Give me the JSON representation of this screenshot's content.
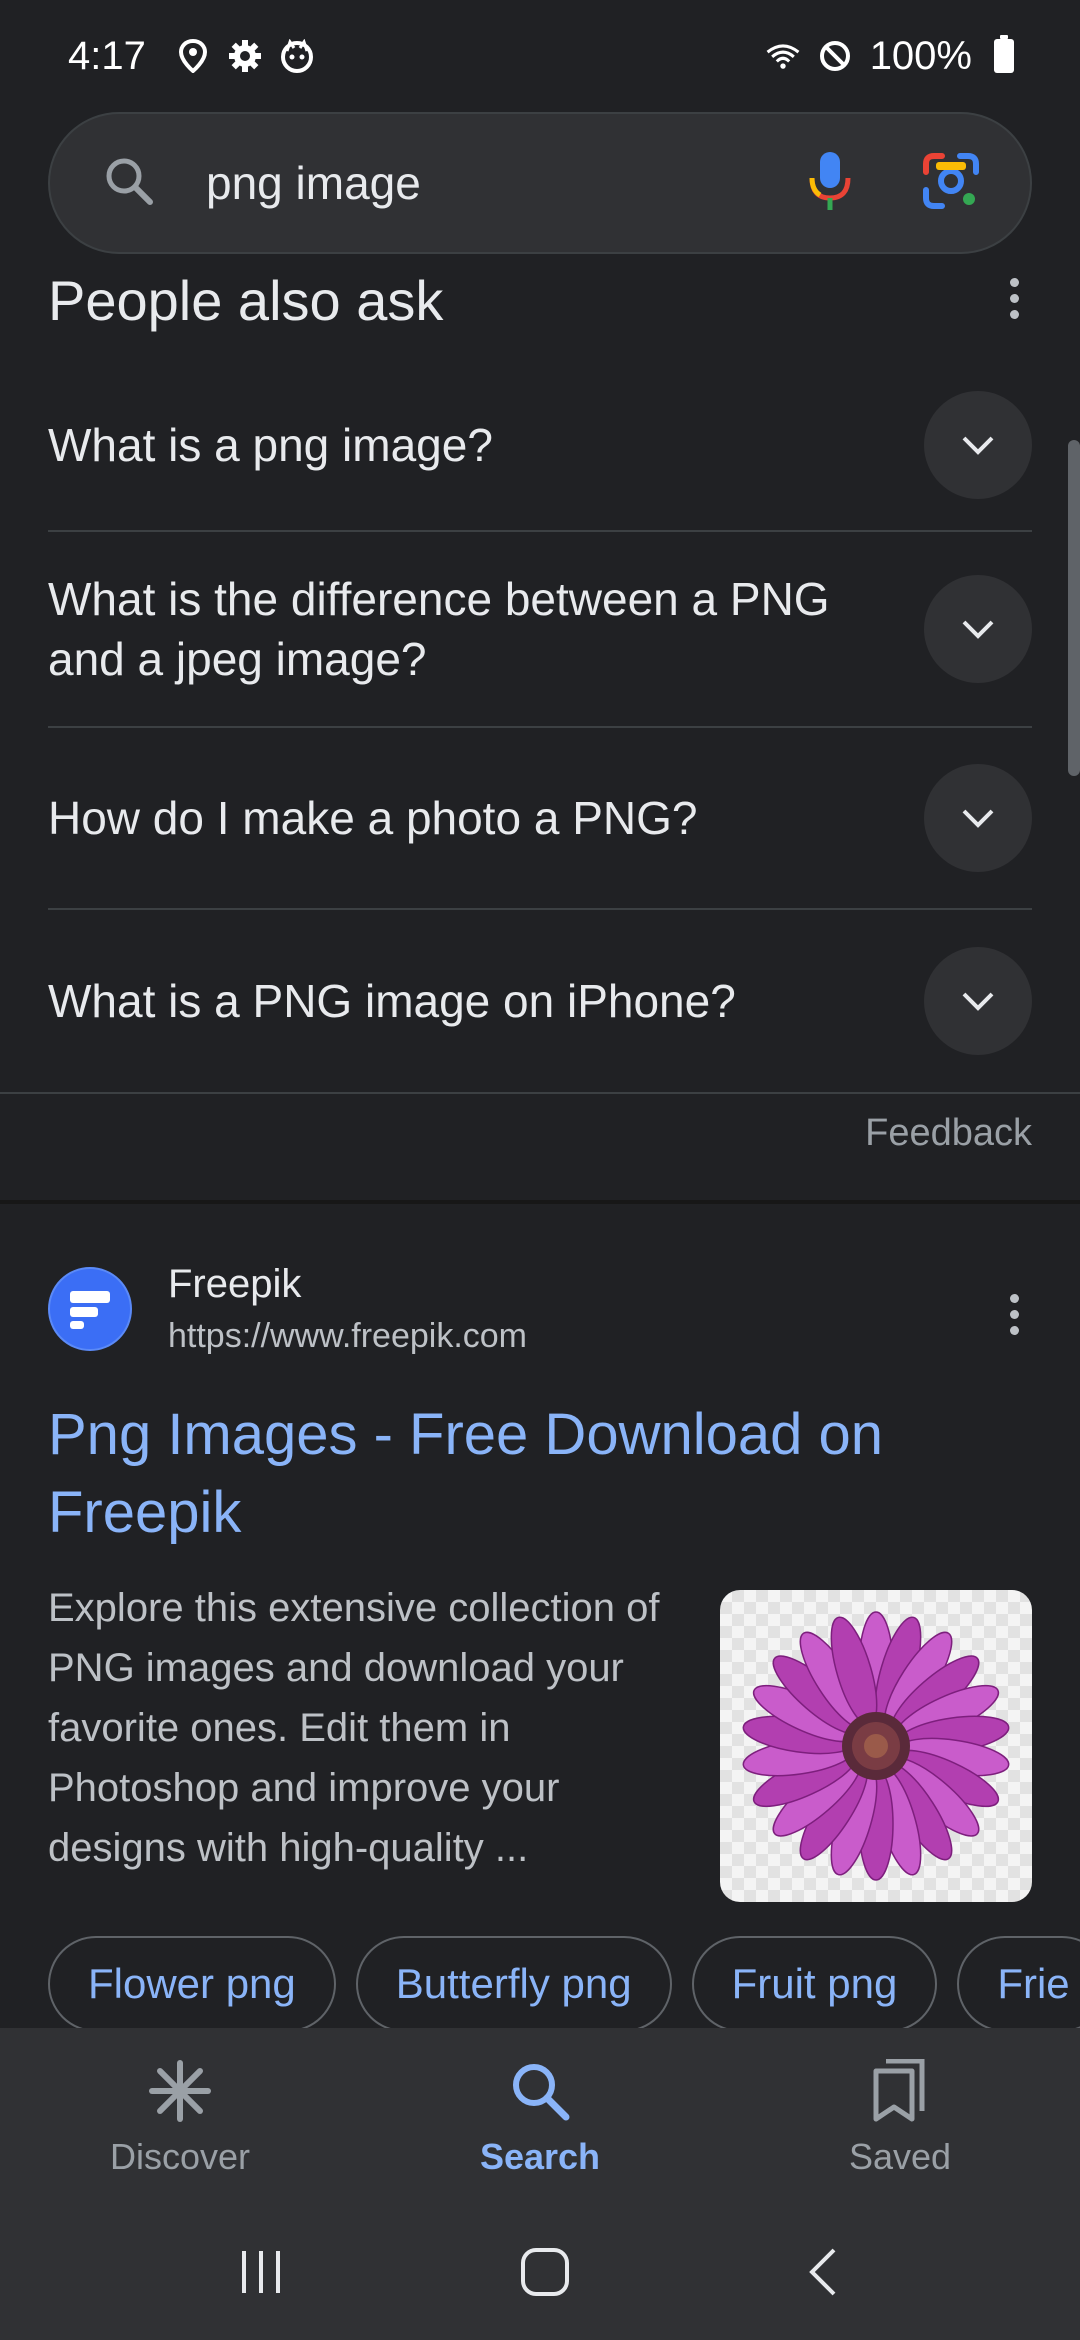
{
  "status_bar": {
    "time": "4:17",
    "battery": "100%"
  },
  "search": {
    "query": "png image"
  },
  "paa": {
    "title": "People also ask",
    "questions": [
      "What is a png image?",
      "What is the difference between a PNG and a jpeg image?",
      "How do I make a photo a PNG?",
      "What is a PNG image on iPhone?"
    ],
    "feedback": "Feedback"
  },
  "result": {
    "site_name": "Freepik",
    "url": "https://www.freepik.com",
    "title": "Png Images - Free Download on Freepik",
    "snippet": "Explore this extensive collection of PNG images and download your favorite ones. Edit them in Photoshop and improve your designs with high-quality ...",
    "chips": [
      "Flower png",
      "Butterfly png",
      "Fruit png",
      "Frie"
    ]
  },
  "bottom_nav": {
    "items": [
      {
        "label": "Discover",
        "icon": "asterisk-icon"
      },
      {
        "label": "Search",
        "icon": "search-icon"
      },
      {
        "label": "Saved",
        "icon": "bookmarks-icon"
      }
    ]
  },
  "colors": {
    "background": "#202124",
    "link": "#8ab4f8",
    "surface": "#303134"
  }
}
